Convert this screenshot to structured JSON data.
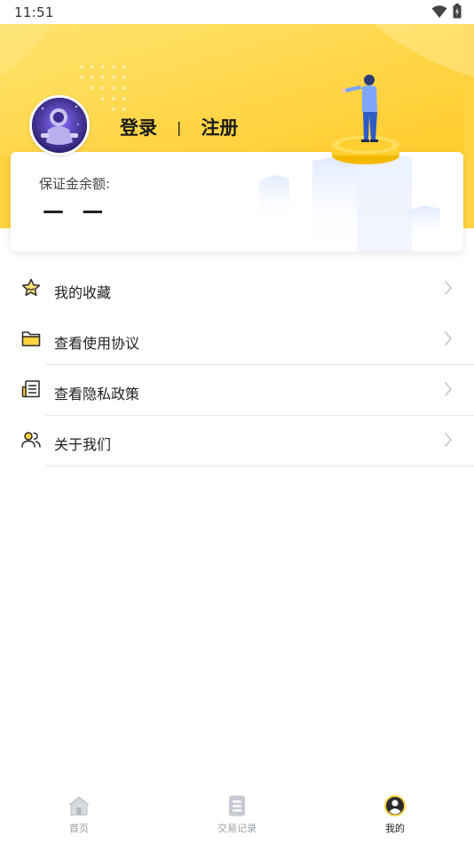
{
  "status_bar": {
    "time": "11:51"
  },
  "header": {
    "login_label": "登录",
    "separator": "|",
    "register_label": "注册",
    "accent_color": "#FFD23F"
  },
  "balance": {
    "label": "保证金余额:",
    "value": "— —"
  },
  "menu": {
    "items": [
      {
        "label": "我的收藏",
        "icon": "star-icon"
      },
      {
        "label": "查看使用协议",
        "icon": "folder-icon"
      },
      {
        "label": "查看隐私政策",
        "icon": "document-icon"
      },
      {
        "label": "关于我们",
        "icon": "people-icon"
      }
    ]
  },
  "bottom_nav": {
    "items": [
      {
        "label": "首页",
        "icon": "home-icon"
      },
      {
        "label": "交易记录",
        "icon": "records-icon"
      },
      {
        "label": "我的",
        "icon": "profile-icon",
        "active": true
      }
    ]
  }
}
